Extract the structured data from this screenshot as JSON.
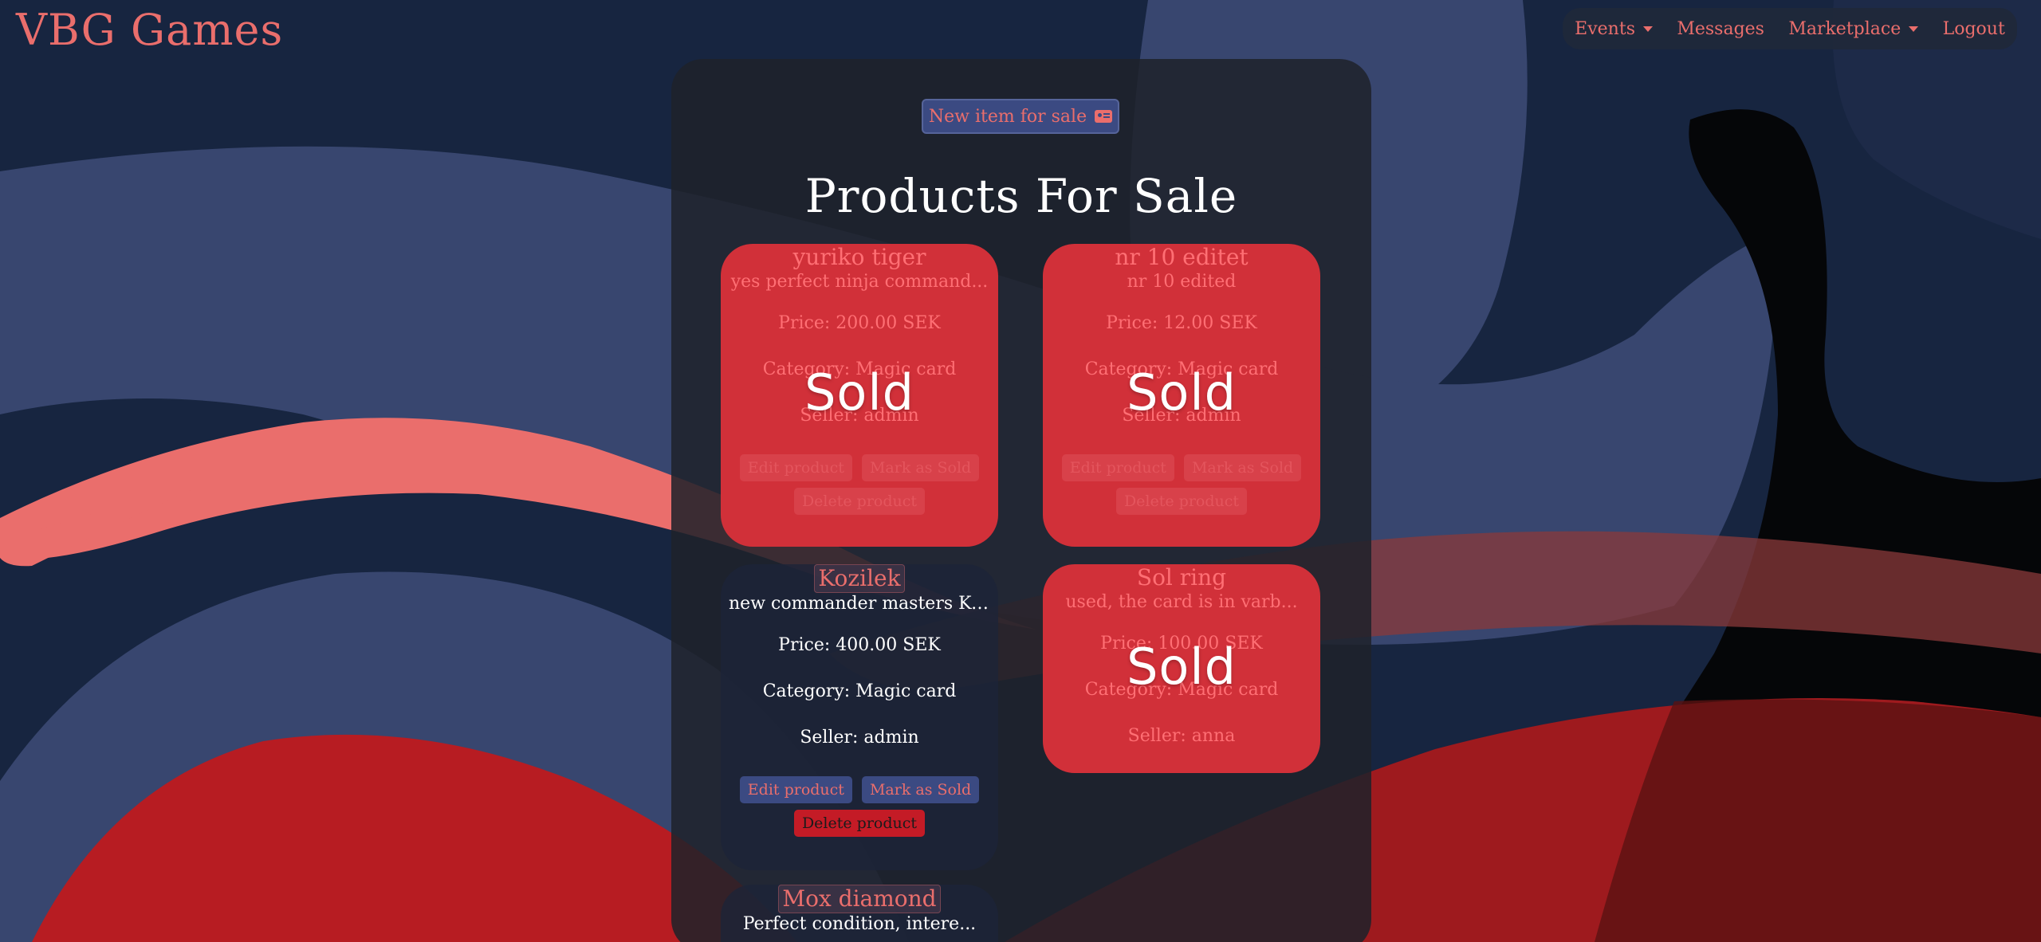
{
  "brand": "VBG Games",
  "nav": {
    "events": "Events",
    "messages": "Messages",
    "marketplace": "Marketplace",
    "logout": "Logout"
  },
  "new_item_label": "New item for sale",
  "page_title": "Products For Sale",
  "sold_label": "Sold",
  "buttons": {
    "edit": "Edit product",
    "mark_sold": "Mark as Sold",
    "delete": "Delete product"
  },
  "products": [
    {
      "name": "yuriko tiger",
      "description": "yes perfect ninja command...",
      "price": "Price: 200.00 SEK",
      "category": "Category: Magic card",
      "seller": "Seller: admin",
      "sold": true
    },
    {
      "name": "nr 10 editet",
      "description": "nr 10 edited",
      "price": "Price: 12.00 SEK",
      "category": "Category: Magic card",
      "seller": "Seller: admin",
      "sold": true
    },
    {
      "name": "Kozilek",
      "description": "new commander masters Koz...",
      "price": "Price: 400.00 SEK",
      "category": "Category: Magic card",
      "seller": "Seller: admin",
      "sold": false
    },
    {
      "name": "Sol ring",
      "description": "used, the card is in varb...",
      "price": "Price: 100.00 SEK",
      "category": "Category: Magic card",
      "seller": "Seller: anna",
      "sold": true
    },
    {
      "name": "Mox diamond",
      "description": "Perfect condition, intere...",
      "sold": false
    }
  ],
  "colors": {
    "background": "#172540",
    "accent": "#ea6e6c",
    "sold_card": "#d13039",
    "button_blue": "#3b4a82",
    "button_red": "#c41b26"
  }
}
